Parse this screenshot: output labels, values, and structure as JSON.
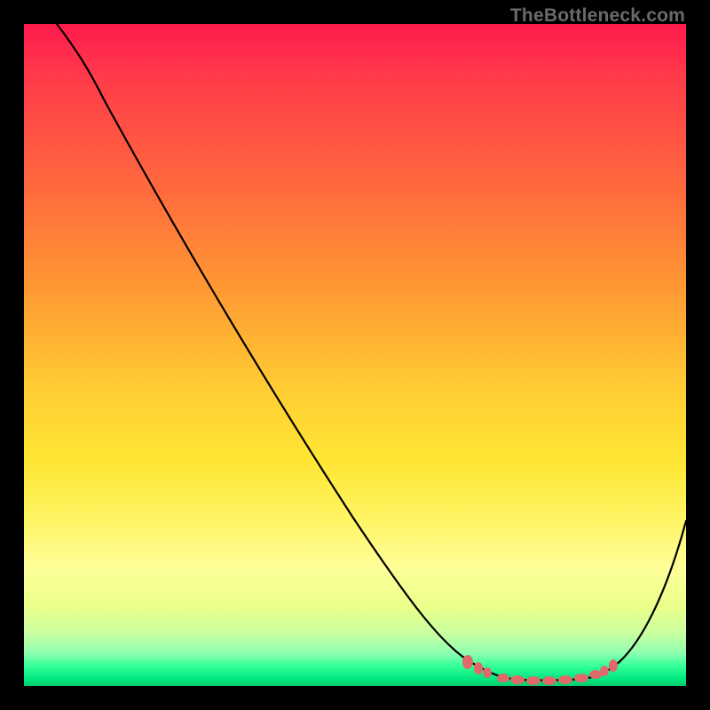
{
  "watermark": "TheBottleneck.com",
  "colors": {
    "frame": "#000000",
    "curve": "#000000",
    "marker": "#e06a6a",
    "gradient_stops": [
      "#ff1a4d",
      "#ff6a3d",
      "#ffcc33",
      "#ffff99",
      "#00cc6a"
    ]
  },
  "chart_data": {
    "type": "line",
    "title": "",
    "xlabel": "",
    "ylabel": "",
    "xlim": [
      0,
      100
    ],
    "ylim": [
      0,
      100
    ],
    "note": "x is relative horizontal position (0 left, 100 right). y is bottleneck % (0 bottom/best, 100 top/worst). Curve: steep descent from upper-left to a flat minimum near x≈72–86, then rises toward the right edge.",
    "series": [
      {
        "name": "bottleneck-curve",
        "x": [
          5,
          10,
          15,
          20,
          25,
          30,
          35,
          40,
          45,
          50,
          55,
          60,
          65,
          70,
          72,
          75,
          78,
          80,
          83,
          86,
          88,
          90,
          93,
          96,
          100
        ],
        "y": [
          100,
          95,
          88,
          80,
          72,
          64,
          56,
          48,
          40,
          32,
          25,
          18,
          12,
          6,
          3,
          1.5,
          1,
          1,
          1,
          1.5,
          3,
          6,
          12,
          20,
          30
        ]
      }
    ],
    "markers": {
      "name": "highlighted-range",
      "x": [
        67,
        69,
        72,
        74,
        76,
        78,
        80,
        82,
        84,
        86,
        87,
        88
      ],
      "y": [
        5.5,
        4.0,
        2.6,
        1.8,
        1.2,
        1.0,
        1.0,
        1.0,
        1.2,
        1.8,
        2.4,
        3.2
      ]
    }
  }
}
